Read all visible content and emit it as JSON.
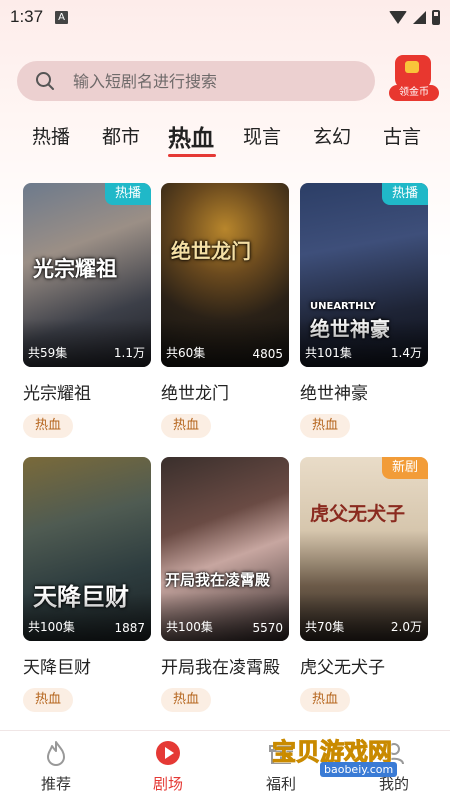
{
  "status": {
    "time": "1:37",
    "a_icon": "A"
  },
  "search": {
    "placeholder": "输入短剧名进行搜索"
  },
  "coin": {
    "label": "领金币"
  },
  "tabs": [
    "热播",
    "都市",
    "热血",
    "现言",
    "玄幻",
    "古言"
  ],
  "active_tab": "热血",
  "dramas": [
    {
      "title": "光宗耀祖",
      "poster_text": "光宗耀祖",
      "episodes": "共59集",
      "views": "1.1万",
      "badge": "热播",
      "tag": "热血"
    },
    {
      "title": "绝世龙门",
      "poster_text": "绝世龙门",
      "episodes": "共60集",
      "views": "4805",
      "badge": "",
      "tag": "热血"
    },
    {
      "title": "绝世神豪",
      "poster_text": "绝世神豪",
      "poster_sub": "UNEARTHLY",
      "episodes": "共101集",
      "views": "1.4万",
      "badge": "热播",
      "tag": "热血"
    },
    {
      "title": "天降巨财",
      "poster_text": "天降巨财",
      "episodes": "共100集",
      "views": "1887",
      "badge": "",
      "tag": "热血"
    },
    {
      "title": "开局我在凌霄殿",
      "poster_text": "开局我在凌霄殿",
      "episodes": "共100集",
      "views": "5570",
      "badge": "",
      "tag": "热血"
    },
    {
      "title": "虎父无犬子",
      "poster_text": "虎父无犬子",
      "episodes": "共70集",
      "views": "2.0万",
      "badge": "新剧",
      "tag": "热血"
    }
  ],
  "nav": [
    {
      "label": "推荐",
      "icon": "flame-icon"
    },
    {
      "label": "剧场",
      "icon": "play-icon"
    },
    {
      "label": "福利",
      "icon": "gift-icon"
    },
    {
      "label": "我的",
      "icon": "user-icon"
    }
  ],
  "watermark": {
    "text": "宝贝游戏网",
    "url": "baobeiy.com"
  },
  "colors": {
    "accent": "#e53935",
    "badge_hot": "#20b8c8",
    "badge_new": "#f29c38",
    "tag_bg": "#fbeee3",
    "tag_text": "#b5651d",
    "search_bg": "#ecd0d0"
  }
}
